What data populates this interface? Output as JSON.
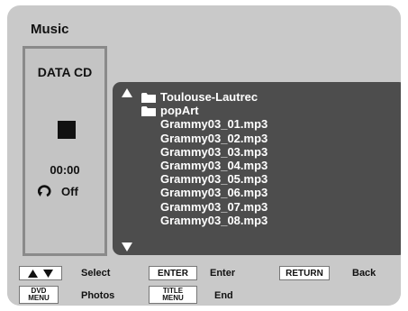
{
  "header": {
    "title": "Music"
  },
  "status": {
    "disc_type": "DATA CD",
    "time": "00:00",
    "repeat": "Off"
  },
  "file_list": {
    "items": [
      {
        "type": "folder",
        "name": "Toulouse-Lautrec"
      },
      {
        "type": "folder",
        "name": "popArt"
      },
      {
        "type": "file",
        "name": "Grammy03_01.mp3"
      },
      {
        "type": "file",
        "name": "Grammy03_02.mp3"
      },
      {
        "type": "file",
        "name": "Grammy03_03.mp3"
      },
      {
        "type": "file",
        "name": "Grammy03_04.mp3"
      },
      {
        "type": "file",
        "name": "Grammy03_05.mp3"
      },
      {
        "type": "file",
        "name": "Grammy03_06.mp3"
      },
      {
        "type": "file",
        "name": "Grammy03_07.mp3"
      },
      {
        "type": "file",
        "name": "Grammy03_08.mp3"
      }
    ]
  },
  "footer": {
    "select_label": "Select",
    "enter_key": "ENTER",
    "enter_label": "Enter",
    "return_key": "RETURN",
    "back_label": "Back",
    "dvd_menu_key_line1": "DVD",
    "dvd_menu_key_line2": "MENU",
    "photos_label": "Photos",
    "title_menu_key_line1": "TITLE",
    "title_menu_key_line2": "MENU",
    "end_label": "End"
  },
  "colors": {
    "screen_bg": "#c9c9c9",
    "list_bg": "#4d4d4d",
    "list_text": "#ffffff"
  }
}
